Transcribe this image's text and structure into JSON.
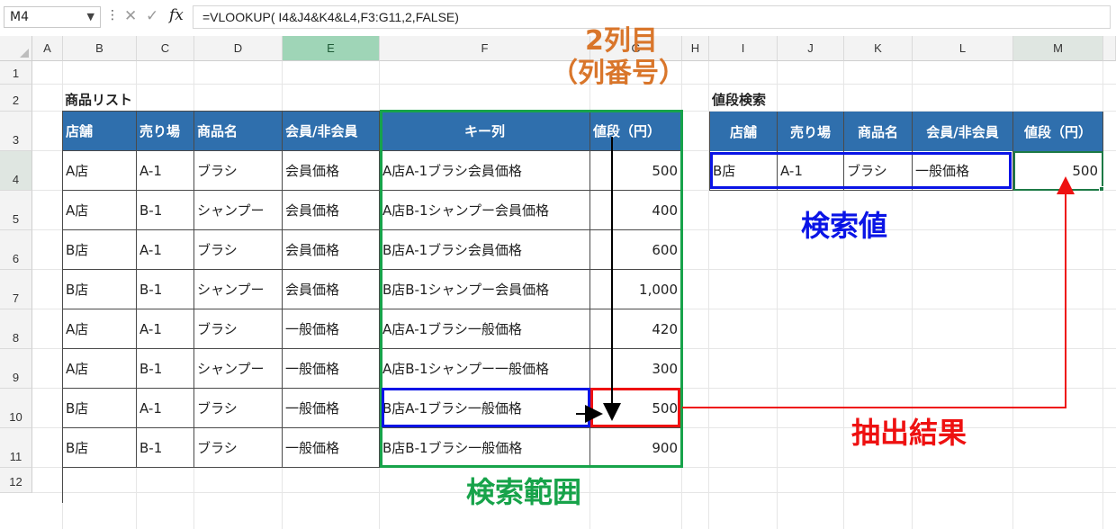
{
  "formula_bar": {
    "name_box": "M4",
    "formula": "=VLOOKUP( I4&J4&K4&L4,F3:G11,2,FALSE)"
  },
  "columns": [
    "A",
    "B",
    "C",
    "D",
    "E",
    "F",
    "G",
    "H",
    "I",
    "J",
    "K",
    "L",
    "M"
  ],
  "rows": [
    "1",
    "2",
    "3",
    "4",
    "5",
    "6",
    "7",
    "8",
    "9",
    "10",
    "11",
    "12"
  ],
  "selection": {
    "active_cell": "M4",
    "highlight_column": "E"
  },
  "left_table": {
    "title": "商品リスト",
    "headers": [
      "店舗",
      "売り場",
      "商品名",
      "会員/非会員",
      "キー列",
      "値段（円）"
    ],
    "rows": [
      [
        "A店",
        "A-1",
        "ブラシ",
        "会員価格",
        "A店A-1ブラシ会員価格",
        "500"
      ],
      [
        "A店",
        "B-1",
        "シャンプー",
        "会員価格",
        "A店B-1シャンプー会員価格",
        "400"
      ],
      [
        "B店",
        "A-1",
        "ブラシ",
        "会員価格",
        "B店A-1ブラシ会員価格",
        "600"
      ],
      [
        "B店",
        "B-1",
        "シャンプー",
        "会員価格",
        "B店B-1シャンプー会員価格",
        "1,000"
      ],
      [
        "A店",
        "A-1",
        "ブラシ",
        "一般価格",
        "A店A-1ブラシ一般価格",
        "420"
      ],
      [
        "A店",
        "B-1",
        "シャンプー",
        "一般価格",
        "A店B-1シャンプー一般価格",
        "300"
      ],
      [
        "B店",
        "A-1",
        "ブラシ",
        "一般価格",
        "B店A-1ブラシ一般価格",
        "500"
      ],
      [
        "B店",
        "B-1",
        "ブラシ",
        "一般価格",
        "B店B-1ブラシ一般価格",
        "900"
      ]
    ]
  },
  "right_table": {
    "title": "値段検索",
    "headers": [
      "店舗",
      "売り場",
      "商品名",
      "会員/非会員",
      "値段（円）"
    ],
    "row": [
      "B店",
      "A-1",
      "ブラシ",
      "一般価格",
      "500"
    ]
  },
  "annotations": {
    "column_number": "2列目",
    "column_number_sub": "（列番号）",
    "lookup_value": "検索値",
    "search_range": "検索範囲",
    "result": "抽出結果"
  },
  "colors": {
    "header_fill": "#2f6fad",
    "green": "#17a34a",
    "blue": "#0a14e6",
    "red": "#ee1111",
    "orange": "#d9762b"
  }
}
